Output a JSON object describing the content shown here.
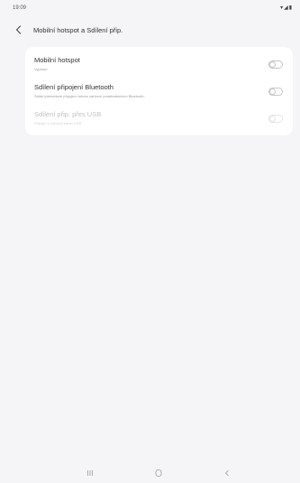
{
  "status_bar": {
    "time": "19:09",
    "icons_text": "▾◢▮"
  },
  "header": {
    "title": "Mobilní hotspot a Sdílení přip."
  },
  "settings": {
    "items": [
      {
        "title": "Mobilní hotspot",
        "subtitle": "Vypnuto",
        "enabled": false,
        "disabled": false
      },
      {
        "title": "Sdílení připojení Bluetooth",
        "subtitle": "Sdílet internetové připojení tohoto zařízení prostřednictvím Bluetooth.",
        "enabled": false,
        "disabled": false
      },
      {
        "title": "Sdílení přip. přes USB",
        "subtitle": "Připojte k zařízení kabel USB.",
        "enabled": false,
        "disabled": true
      }
    ]
  },
  "nav_bar": {
    "buttons": [
      "recents-icon",
      "home-icon",
      "back-icon"
    ]
  },
  "colors": {
    "background": "#f5f5f7",
    "card": "#ffffff",
    "toggle_border": "#c6c6c6"
  }
}
